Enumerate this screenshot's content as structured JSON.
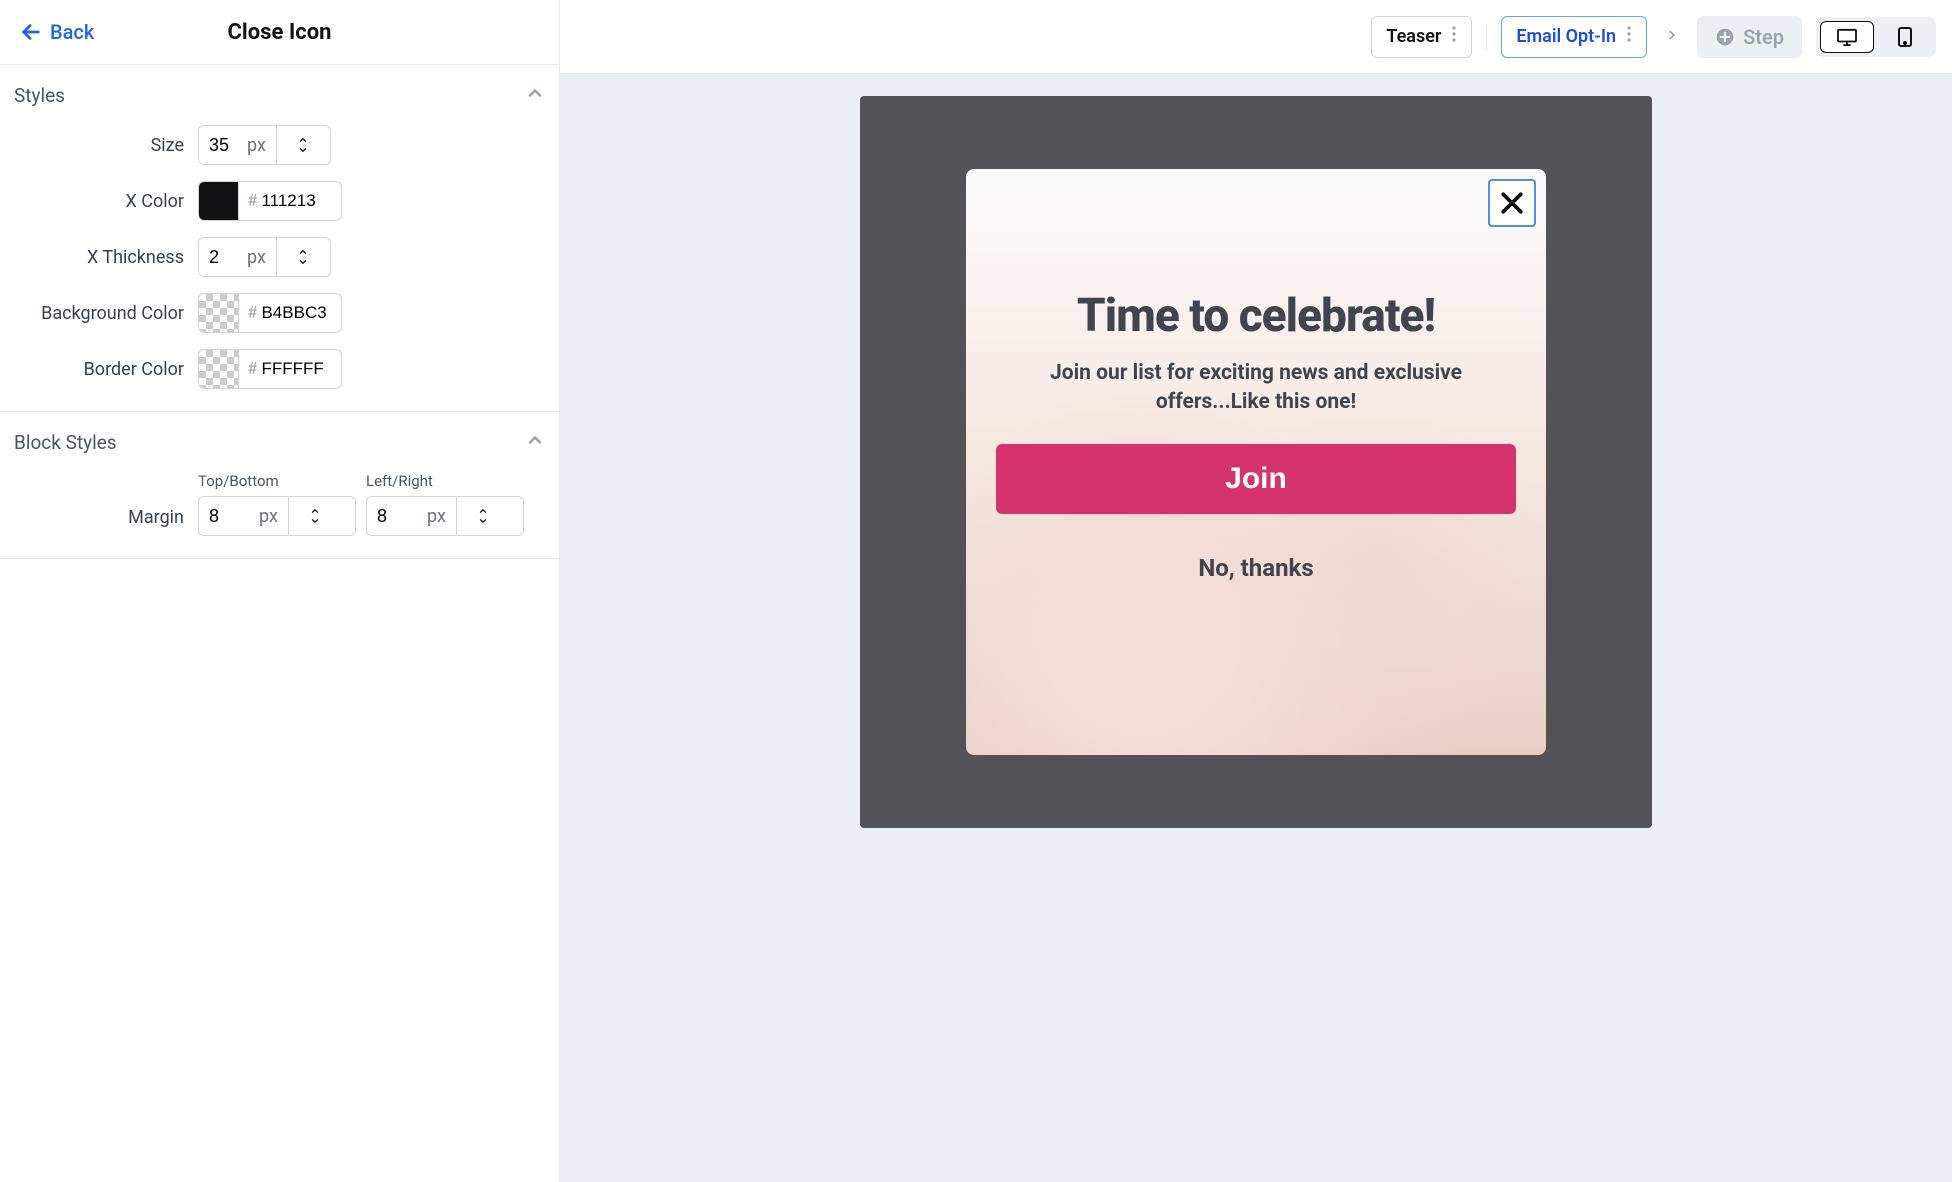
{
  "sidebar": {
    "back_label": "Back",
    "title": "Close Icon",
    "sections": {
      "styles": {
        "title": "Styles",
        "size": {
          "label": "Size",
          "value": "35",
          "unit": "px"
        },
        "x_color": {
          "label": "X Color",
          "value": "111213",
          "swatch": "#111213"
        },
        "x_thickness": {
          "label": "X Thickness",
          "value": "2",
          "unit": "px"
        },
        "bg_color": {
          "label": "Background Color",
          "value": "B4BBC3"
        },
        "border_color": {
          "label": "Border Color",
          "value": "FFFFFF"
        }
      },
      "block_styles": {
        "title": "Block Styles",
        "margin_label": "Margin",
        "tb": {
          "label": "Top/Bottom",
          "value": "8",
          "unit": "px"
        },
        "lr": {
          "label": "Left/Right",
          "value": "8",
          "unit": "px"
        }
      }
    }
  },
  "topbar": {
    "teaser": "Teaser",
    "email_optin": "Email Opt-In",
    "add_step": "Step"
  },
  "popup": {
    "heading": "Time to celebrate!",
    "body": "Join our list for exciting news and exclusive offers...Like this one!",
    "cta": "Join",
    "decline": "No, thanks"
  }
}
